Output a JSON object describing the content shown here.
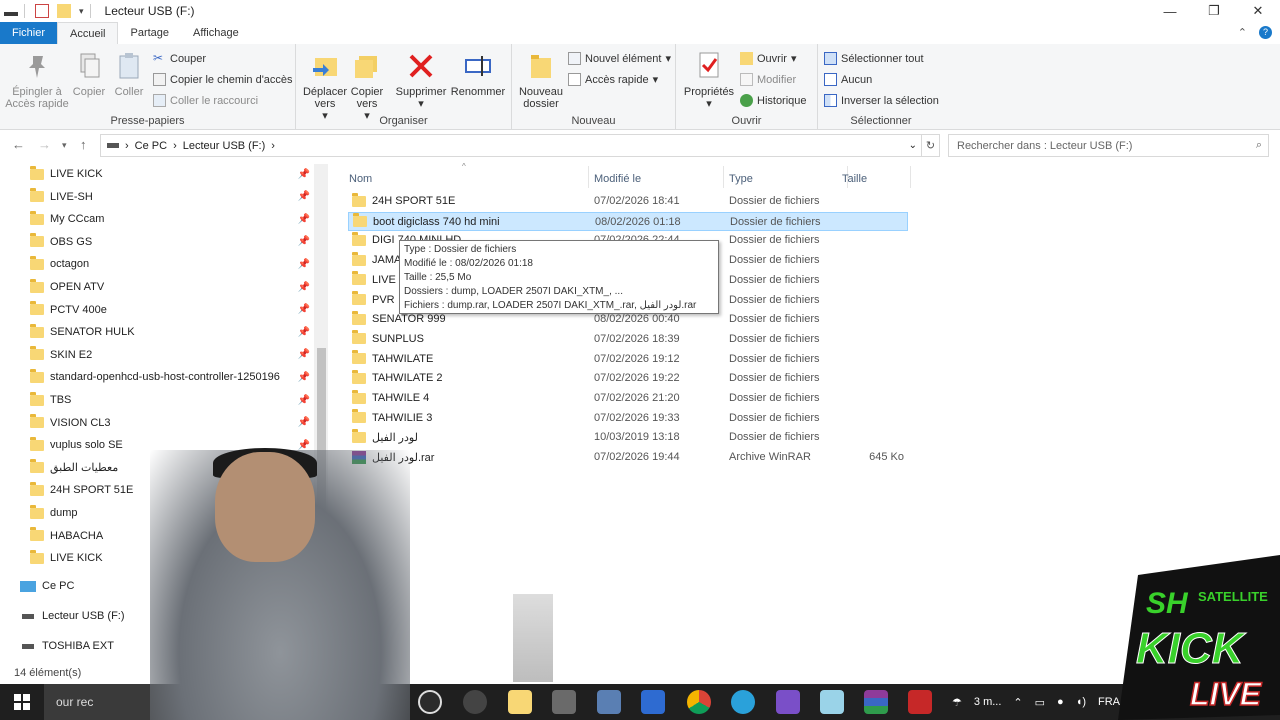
{
  "window": {
    "title": "Lecteur USB (F:)",
    "controls": [
      "—",
      "❐",
      "✕"
    ]
  },
  "ribbon_tabs": [
    "Fichier",
    "Accueil",
    "Partage",
    "Affichage"
  ],
  "ribbon": {
    "groups": {
      "presse_papiers": "Presse-papiers",
      "organiser": "Organiser",
      "nouveau": "Nouveau",
      "ouvrir": "Ouvrir",
      "selectionner": "Sélectionner"
    },
    "buttons": {
      "epingler": "Épingler à Accès rapide",
      "copier": "Copier",
      "coller": "Coller",
      "couper": "Couper",
      "copier_chemin": "Copier le chemin d'accès",
      "coller_raccourci": "Coller le raccourci",
      "deplacer_vers": "Déplacer vers",
      "copier_vers": "Copier vers",
      "supprimer": "Supprimer",
      "renommer": "Renommer",
      "nouveau_dossier": "Nouveau dossier",
      "nouvel_element": "Nouvel élément",
      "acces_rapide": "Accès rapide",
      "proprietes": "Propriétés",
      "ouvrir": "Ouvrir",
      "modifier": "Modifier",
      "historique": "Historique",
      "selectionner_tout": "Sélectionner tout",
      "aucun": "Aucun",
      "inverser": "Inverser la sélection"
    }
  },
  "address": {
    "path": [
      "Ce PC",
      "Lecteur USB (F:)"
    ],
    "search_placeholder": "Rechercher dans : Lecteur USB (F:)"
  },
  "nav_pane": {
    "quick_access": [
      "LIVE KICK",
      "LIVE-SH",
      "My CCcam",
      "OBS GS",
      "octagon",
      "OPEN ATV",
      "PCTV 400e",
      "SENATOR HULK",
      "SKIN E2",
      "standard-openhcd-usb-host-controller-1250196",
      "TBS",
      "VISION CL3",
      "vuplus solo SE",
      "معطيات الطبق",
      "24H SPORT 51E",
      "dump",
      "HABACHA",
      "LIVE KICK"
    ],
    "this_pc": "Ce PC",
    "drives": [
      "Lecteur USB (F:)",
      "TOSHIBA EXT"
    ]
  },
  "columns": {
    "name": "Nom",
    "modified": "Modifié le",
    "type": "Type",
    "size": "Taille"
  },
  "files": [
    {
      "name": "24H SPORT 51E",
      "date": "07/02/2026 18:41",
      "type": "Dossier de fichiers",
      "size": ""
    },
    {
      "name": "boot digiclass 740 hd mini",
      "date": "08/02/2026 01:18",
      "type": "Dossier de fichiers",
      "size": ""
    },
    {
      "name": "DIGI 740 MINI HD",
      "date": "07/02/2026 22:44",
      "type": "Dossier de fichiers",
      "size": ""
    },
    {
      "name": "JAMAL",
      "date": "",
      "type": "Dossier de fichiers",
      "size": ""
    },
    {
      "name": "LIVE KICK",
      "date": "",
      "type": "Dossier de fichiers",
      "size": ""
    },
    {
      "name": "PVR",
      "date": "",
      "type": "Dossier de fichiers",
      "size": ""
    },
    {
      "name": "SENATOR 999",
      "date": "08/02/2026 00:40",
      "type": "Dossier de fichiers",
      "size": ""
    },
    {
      "name": "SUNPLUS",
      "date": "07/02/2026 18:39",
      "type": "Dossier de fichiers",
      "size": ""
    },
    {
      "name": "TAHWILATE",
      "date": "07/02/2026 19:12",
      "type": "Dossier de fichiers",
      "size": ""
    },
    {
      "name": "TAHWILATE 2",
      "date": "07/02/2026 19:22",
      "type": "Dossier de fichiers",
      "size": ""
    },
    {
      "name": "TAHWILE 4",
      "date": "07/02/2026 21:20",
      "type": "Dossier de fichiers",
      "size": ""
    },
    {
      "name": "TAHWILIE 3",
      "date": "07/02/2026 19:33",
      "type": "Dossier de fichiers",
      "size": ""
    },
    {
      "name": "لودر الفيل",
      "date": "10/03/2019 13:18",
      "type": "Dossier de fichiers",
      "size": ""
    },
    {
      "name": "لودر الفيل.rar",
      "date": "07/02/2026 19:44",
      "type": "Archive WinRAR",
      "size": "645 Ko"
    }
  ],
  "tooltip": {
    "line1": "Type : Dossier de fichiers",
    "line2": "Modifié le : 08/02/2026 01:18",
    "line3": "Taille : 25,5 Mo",
    "line4": "Dossiers : dump, LOADER 2507I DAKI_XTM_, ...",
    "line5": "Fichiers : dump.rar, LOADER 2507I DAKI_XTM_.rar, لودر الفيل.rar"
  },
  "status": {
    "count": "14 élément(s)"
  },
  "taskbar": {
    "search": "our rec",
    "weather": "3 m...",
    "lang": "FRA"
  },
  "overlay": {
    "logo_line1": "SH SATELLITE",
    "logo_line2": "KICK",
    "logo_line3": "LIVE"
  },
  "colors": {
    "accent": "#1979ca",
    "selection": "#cce8ff",
    "folder": "#f8d775",
    "logo_green": "#39d12b"
  }
}
